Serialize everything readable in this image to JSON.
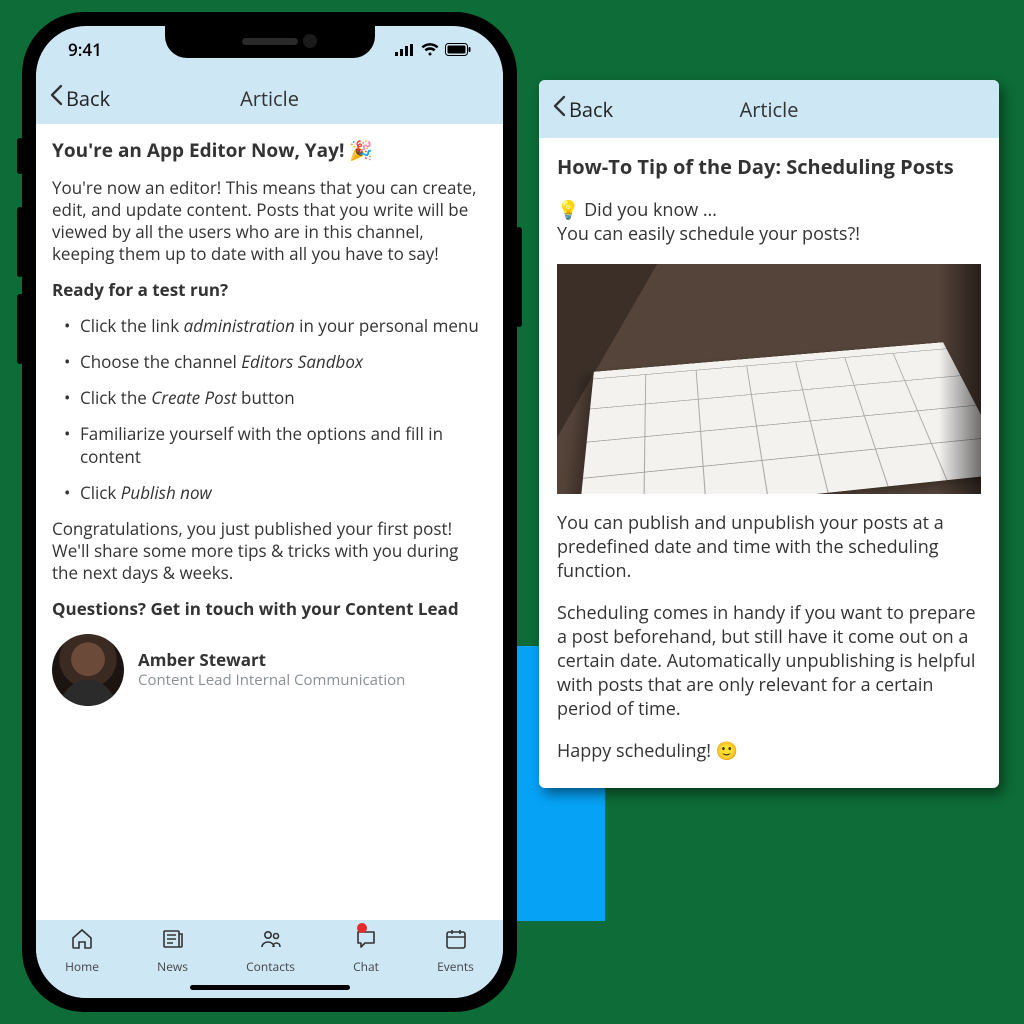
{
  "phone": {
    "status_time": "9:41",
    "nav": {
      "back": "Back",
      "title": "Article"
    },
    "article": {
      "title": "You're an App Editor Now, Yay! 🎉",
      "intro": "You're now an editor! This means that you can create, edit, and update content. Posts that you write will be viewed by all the users who are in this channel, keeping them up to date with all you have to say!",
      "subheading": "Ready for a test run?",
      "steps": [
        {
          "pre": "Click the link ",
          "em": "administration",
          "post": " in your personal menu"
        },
        {
          "pre": "Choose the channel ",
          "em": "Editors Sandbox",
          "post": ""
        },
        {
          "pre": "Click the ",
          "em": "Create Post",
          "post": " button"
        },
        {
          "pre": "Familiarize yourself with the options and fill in content",
          "em": "",
          "post": ""
        },
        {
          "pre": "Click ",
          "em": "Publish now",
          "post": ""
        }
      ],
      "outro1": "Congratulations, you just published your first post!",
      "outro2": "We'll share some more tips & tricks with you during the next days & weeks.",
      "questions": "Questions? Get in touch with your Content Lead",
      "person": {
        "name": "Amber Stewart",
        "role": "Content Lead Internal Communication"
      }
    },
    "tabs": [
      {
        "label": "Home"
      },
      {
        "label": "News"
      },
      {
        "label": "Contacts"
      },
      {
        "label": "Chat",
        "badge": true
      },
      {
        "label": "Events"
      }
    ]
  },
  "card": {
    "nav": {
      "back": "Back",
      "title": "Article"
    },
    "title": "How-To Tip of the Day: Scheduling Posts",
    "lead1": "💡 Did you know …",
    "lead2": "You can easily schedule your posts?!",
    "p1": "You can publish and unpublish your posts at a predefined date and time with the scheduling function.",
    "p2": "Scheduling comes in handy if you want to prepare a post beforehand, but still have it come out on a certain date. Automatically unpublishing is helpful with posts that are only relevant for a certain period of time.",
    "p3": "Happy scheduling! 🙂"
  }
}
